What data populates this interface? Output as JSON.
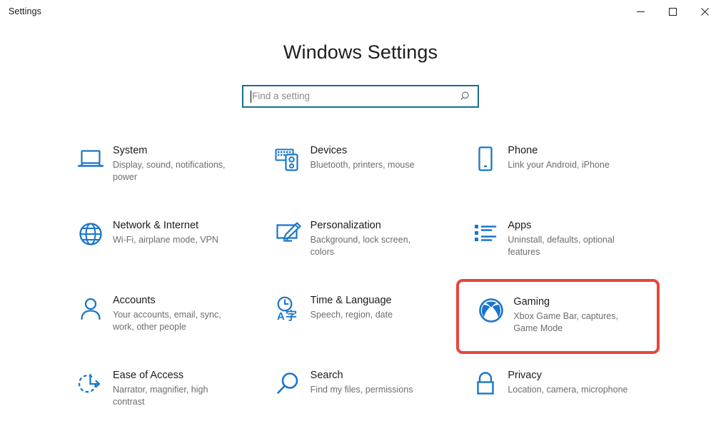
{
  "window": {
    "title": "Settings",
    "controls": [
      {
        "name": "minimize",
        "glyph": "minimize-icon"
      },
      {
        "name": "maximize",
        "glyph": "maximize-icon"
      },
      {
        "name": "close",
        "glyph": "close-icon"
      }
    ]
  },
  "header": {
    "title": "Windows Settings"
  },
  "search": {
    "placeholder": "Find a setting",
    "value": "",
    "icon": "search-icon"
  },
  "colors": {
    "accent_blue": "#0078d4",
    "icon_blue": "#1a76c8",
    "search_border": "#1a6b8f",
    "highlight_red": "#e8453c",
    "title_text": "#1d1d1d",
    "desc_text": "#6d6d6d"
  },
  "categories": [
    {
      "id": "system",
      "icon": "laptop-icon",
      "name": "System",
      "desc": "Display, sound, notifications, power",
      "highlighted": false
    },
    {
      "id": "devices",
      "icon": "devices-icon",
      "name": "Devices",
      "desc": "Bluetooth, printers, mouse",
      "highlighted": false
    },
    {
      "id": "phone",
      "icon": "phone-icon",
      "name": "Phone",
      "desc": "Link your Android, iPhone",
      "highlighted": false
    },
    {
      "id": "network-internet",
      "icon": "globe-icon",
      "name": "Network & Internet",
      "desc": "Wi-Fi, airplane mode, VPN",
      "highlighted": false
    },
    {
      "id": "personalization",
      "icon": "paintbrush-monitor-icon",
      "name": "Personalization",
      "desc": "Background, lock screen, colors",
      "highlighted": false
    },
    {
      "id": "apps",
      "icon": "list-icon",
      "name": "Apps",
      "desc": "Uninstall, defaults, optional features",
      "highlighted": false
    },
    {
      "id": "accounts",
      "icon": "person-icon",
      "name": "Accounts",
      "desc": "Your accounts, email, sync, work, other people",
      "highlighted": false
    },
    {
      "id": "time-language",
      "icon": "clock-language-icon",
      "name": "Time & Language",
      "desc": "Speech, region, date",
      "highlighted": false
    },
    {
      "id": "gaming",
      "icon": "xbox-icon",
      "name": "Gaming",
      "desc": "Xbox Game Bar, captures, Game Mode",
      "highlighted": true
    },
    {
      "id": "ease-of-access",
      "icon": "ease-of-access-icon",
      "name": "Ease of Access",
      "desc": "Narrator, magnifier, high contrast",
      "highlighted": false
    },
    {
      "id": "search",
      "icon": "magnifier-icon",
      "name": "Search",
      "desc": "Find my files, permissions",
      "highlighted": false
    },
    {
      "id": "privacy",
      "icon": "lock-icon",
      "name": "Privacy",
      "desc": "Location, camera, microphone",
      "highlighted": false
    }
  ]
}
